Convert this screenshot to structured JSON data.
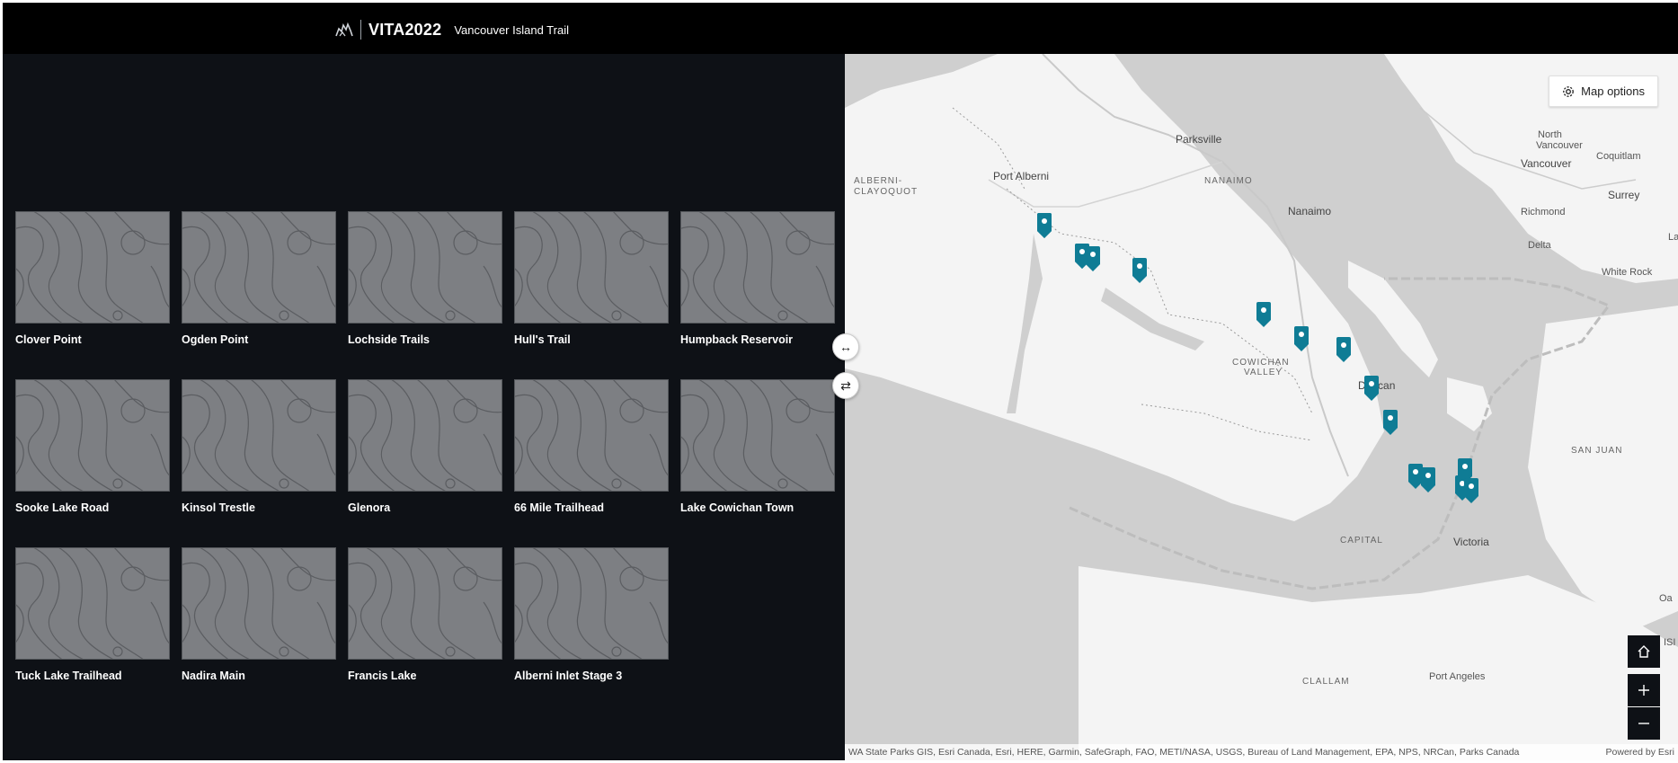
{
  "header": {
    "logo_icon": "bear-logo-icon",
    "short_title": "VITA2022",
    "title": "Vancouver Island Trail"
  },
  "gallery": {
    "items": [
      {
        "label": "Clover Point"
      },
      {
        "label": "Ogden Point"
      },
      {
        "label": "Lochside Trails"
      },
      {
        "label": "Hull's Trail"
      },
      {
        "label": "Humpback Reservoir"
      },
      {
        "label": "Sooke Lake Road"
      },
      {
        "label": "Kinsol Trestle"
      },
      {
        "label": "Glenora"
      },
      {
        "label": "66 Mile Trailhead"
      },
      {
        "label": "Lake Cowichan Town"
      },
      {
        "label": "Tuck Lake Trailhead"
      },
      {
        "label": "Nadira Main"
      },
      {
        "label": "Francis Lake"
      },
      {
        "label": "Alberni Inlet Stage 3"
      }
    ]
  },
  "splitter": {
    "resize_icon": "horizontal-resize-icon",
    "swap_icon": "swap-panels-icon"
  },
  "map": {
    "options_label": "Map options",
    "options_icon": "gear-icon",
    "labels": [
      "Parksville",
      "Port Alberni",
      "ALBERNI-",
      "CLAYOQUOT",
      "NANAIMO",
      "Nanaimo",
      "COWICHAN",
      "VALLEY",
      "Duncan",
      "CAPITAL",
      "Victoria",
      "North",
      "Vancouver",
      "Vancouver",
      "Coquitlam",
      "Surrey",
      "Richmond",
      "Delta",
      "White Rock",
      "SAN JUAN",
      "CLALLAM",
      "Port Angeles",
      "La",
      "Oa",
      "ISI"
    ],
    "marker_color": "#0f7c95",
    "marker_count": 16,
    "home_icon": "home-icon",
    "zoom_in_icon": "plus-icon",
    "zoom_out_icon": "minus-icon",
    "attribution": "WA State Parks GIS, Esri Canada, Esri, HERE, Garmin, SafeGraph, FAO, METI/NASA, USGS, Bureau of Land Management, EPA, NPS, NRCan, Parks Canada",
    "powered_by": "Powered by Esri"
  }
}
